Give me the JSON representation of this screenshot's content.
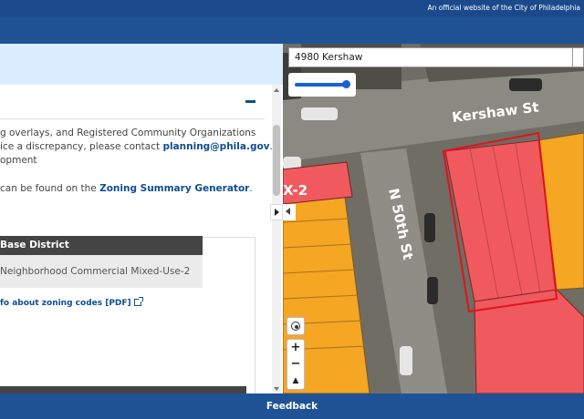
{
  "banner": {
    "official_text": "An official website of the City of Philadelphia"
  },
  "left": {
    "para1": "g overlays, and Registered Community Organizations",
    "para2_pre": "ice a discrepancy, please contact ",
    "para2_email": "planning@phila.gov",
    "para2_post": ".",
    "para3": "opment",
    "para4_pre": "can be found on the ",
    "para4_link": "Zoning Summary Generator",
    "para4_post": ".",
    "base_district_header": "Base District",
    "base_district_value": "Neighborhood Commercial Mixed-Use-2",
    "more_info_link": "fo about zoning codes [PDF]"
  },
  "map": {
    "search_value": "4980 Kershaw",
    "street_kershaw": "Kershaw St",
    "street_50th": "N 50th St",
    "zone_label": "X-2",
    "opacity": 0.9,
    "zoom_in": "+",
    "zoom_out": "−",
    "compass": "▲"
  },
  "footer": {
    "feedback": "Feedback"
  },
  "colors": {
    "accent": "#1f5396",
    "commercial": "#f05a5f",
    "residential": "#f5a623",
    "highlight": "#e0131c"
  }
}
